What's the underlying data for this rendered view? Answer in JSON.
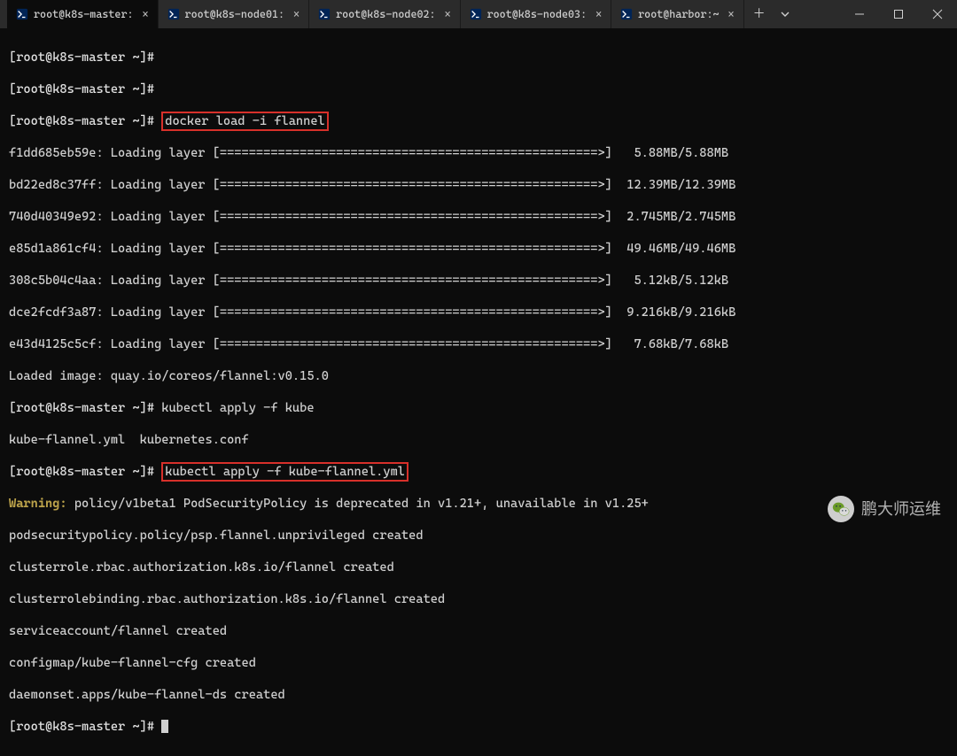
{
  "tabs": [
    {
      "label": "root@k8s-master:",
      "active": true
    },
    {
      "label": "root@k8s-node01:",
      "active": false
    },
    {
      "label": "root@k8s-node02:",
      "active": false
    },
    {
      "label": "root@k8s-node03:",
      "active": false
    },
    {
      "label": "root@harbor:~",
      "active": false
    }
  ],
  "prompt": "[root@k8s-master ~]#",
  "cmd1": "docker load -i flannel",
  "layers": [
    {
      "id": "f1dd685eb59e",
      "bar": "====================================================>",
      "size": "5.88MB/5.88MB"
    },
    {
      "id": "bd22ed8c37ff",
      "bar": "====================================================>",
      "size": "12.39MB/12.39MB"
    },
    {
      "id": "740d40349e92",
      "bar": "====================================================>",
      "size": "2.745MB/2.745MB"
    },
    {
      "id": "e85d1a861cf4",
      "bar": "====================================================>",
      "size": "49.46MB/49.46MB"
    },
    {
      "id": "308c5b04c4aa",
      "bar": "====================================================>",
      "size": "5.12kB/5.12kB"
    },
    {
      "id": "dce2fcdf3a87",
      "bar": "====================================================>",
      "size": "9.216kB/9.216kB"
    },
    {
      "id": "e43d4125c5cf",
      "bar": "====================================================>",
      "size": "7.68kB/7.68kB"
    }
  ],
  "loaded_line": "Loaded image: quay.io/coreos/flannel:v0.15.0",
  "apply_partial": "kubectl apply -f kube",
  "completion_line": "kube-flannel.yml  kubernetes.conf",
  "cmd2": "kubectl apply -f kube-flannel.yml",
  "warn_label": "Warning:",
  "warn_rest": " policy/v1beta1 PodSecurityPolicy is deprecated in v1.21+, unavailable in v1.25+",
  "output_lines": [
    "podsecuritypolicy.policy/psp.flannel.unprivileged created",
    "clusterrole.rbac.authorization.k8s.io/flannel created",
    "clusterrolebinding.rbac.authorization.k8s.io/flannel created",
    "serviceaccount/flannel created",
    "configmap/kube-flannel-cfg created",
    "daemonset.apps/kube-flannel-ds created"
  ],
  "watermark": "鹏大师运维"
}
